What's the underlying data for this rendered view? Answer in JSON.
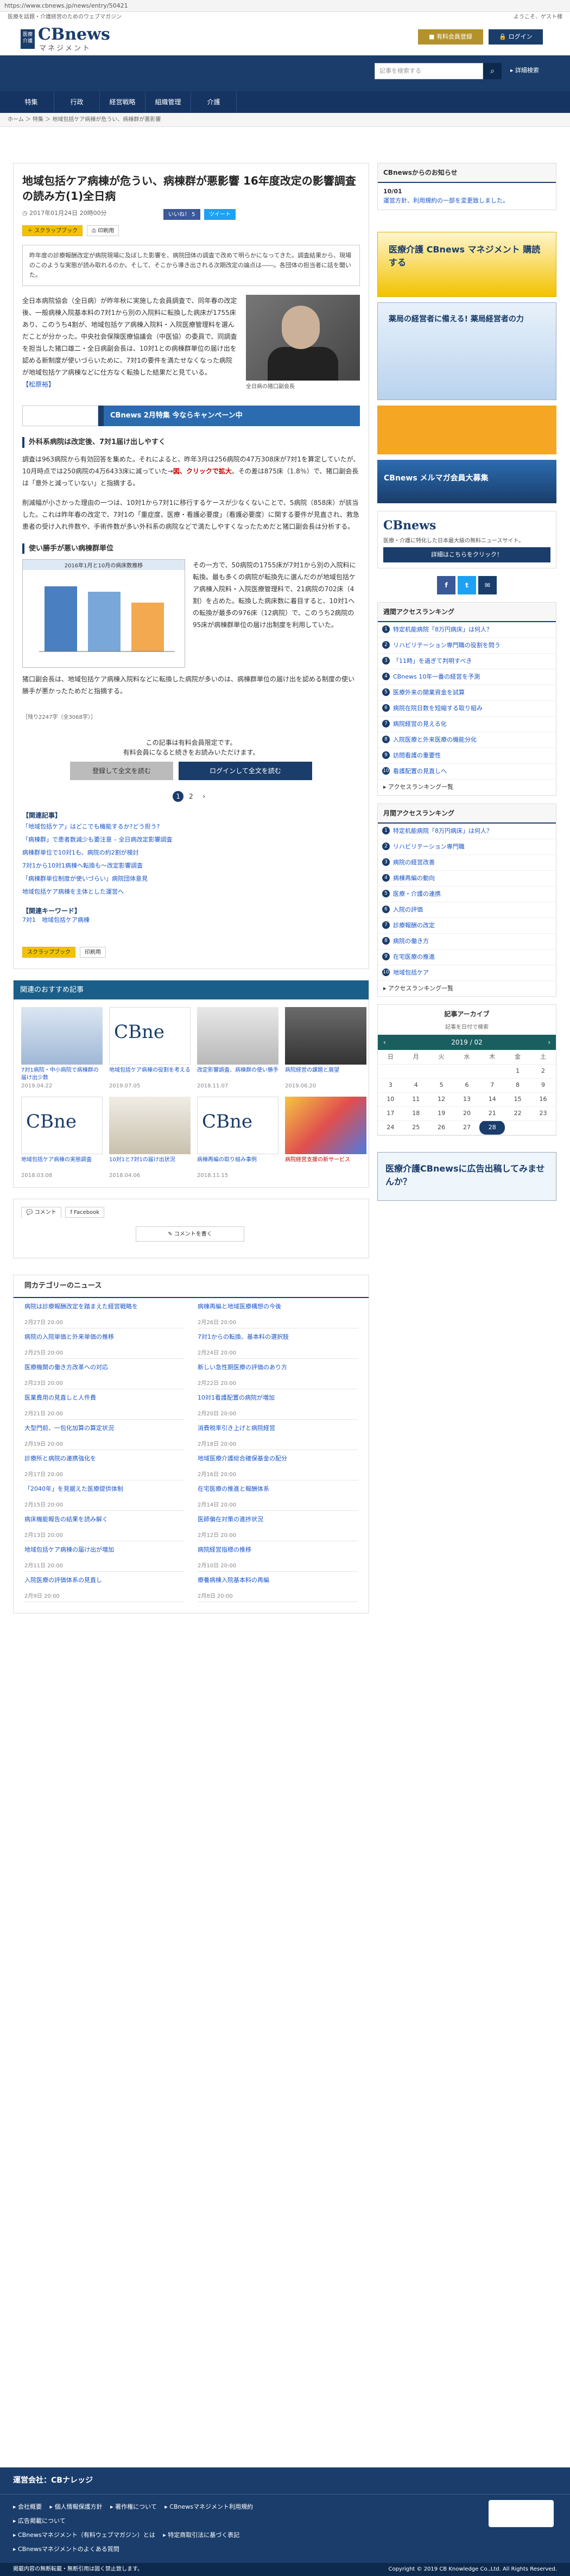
{
  "url": "https://www.cbnews.jp/news/entry/50421",
  "tagline": "医療を話題・介護経営のためのウェブマガジン",
  "welcome": "ようこそ、ゲスト様",
  "logo": {
    "top": "医療介護",
    "title": "CBnews",
    "sub": "マネジメント"
  },
  "header": {
    "trial": "有料会員登録",
    "login": "ログイン"
  },
  "search": {
    "placeholder": "記事を検索する",
    "advanced": "詳細検索"
  },
  "nav": [
    "特集",
    "行政",
    "経営戦略",
    "組織管理",
    "介護"
  ],
  "breadcrumb": "ホーム ＞ 特集 ＞ 地域包括ケア病棟が危うい、病棟群が悪影響",
  "article": {
    "title": "地域包括ケア病棟が危うい、病棟群が悪影響 16年度改定の影響調査の読み方(1)全日病",
    "date": "2017年01月24日 20時00分",
    "like": "いいね！ 5",
    "tweet": "ツイート",
    "scrap": "スクラップブック",
    "print": "印刷用",
    "lead": "昨年度の診療報酬改定が病院現場に及ぼした影響を、病院団体の調査で改めて明らかになってきた。調査結果から、現場のこのような実態が読み取れるのか。そして、そこから導き出される次期改定の論点は――。各団体の担当者に話を聞いた。",
    "p1": "全日本病院協会（全日病）が昨年秋に実施した会員調査で、同年春の改定後、一般病棟入院基本料の7対1から別の入院料に転換した病床が1755床あり、このうち4割が、地域包括ケア病棟入院料・入院医療管理料を選んだことが分かった。中央社会保険医療協議会（中医協）の委員で、同調査を担当した猪口雄二・全日病副会長は、10対1との病棟群単位の届け出を認める新制度が使いづらいために、7対1の要件を満たせなくなった病院が地域包括ケア病棟などに仕方なく転換した結果だと見ている。",
    "p1link": "【松原裕】",
    "cap": "全日病の猪口副会長",
    "banner": "CBnews 2月特集 今ならキャンペーン中",
    "h2a": "外科系病院は改定後、7対1届け出しやすく",
    "p2": "調査は963病院から有効回答を集めた。それによると、昨年3月は256病院の47万308床が7対1を算定していたが、10月時点では250病院の4万6433床に減っていた→",
    "p2link": "図、クリックで拡大",
    "p2b": "。その差は875床（1.8％）で、猪口副会長は「意外と減っていない」と指摘する。",
    "p3": "削減幅が小さかった理由の一つは、10対1から7対1に移行するケースが少なくないことで、5病院（858床）が該当した。これは昨年春の改定で、7対1の「重症度、医療・看護必要度」（看護必要度）に関する要件が見直され、救急患者の受け入れ件数や、手術件数が多い外科系の病院などで満たしやすくなったためだと猪口副会長は分析する。",
    "h2b": "使い勝手が悪い病棟群単位",
    "figtitle": "2016年1月と10月の病床数推移",
    "p4": "その一方で、50病院の1755床が7対1から別の入院料に転換。最も多くの病院が転換先に選んだのが地域包括ケア病棟入院料・入院医療管理料で、21病院の702床（4割）を占めた。転換した病床数に着目すると、10対1への転換が最多の976床（12病院）で、このうち2病院の95床が病棟群単位の届け出制度を利用していた。",
    "p5": "猪口副会長は、地域包括ケア病棟入院料などに転換した病院が多いのは、病棟群単位の届け出を認める制度の使い勝手が悪かったためだと指摘する。",
    "rest": "［残り2247字（全3068字）］",
    "paynote1": "この記事は有料会員限定です。",
    "paynote2": "有料会員になると続きをお読みいただけます。",
    "paybtn1": "登録して全文を読む",
    "paybtn2": "ログインして全文を読む",
    "pages": [
      "1",
      "2",
      "›"
    ],
    "relhd": "【関連記事】",
    "related": [
      "「地域包括ケア」はどこでも機能するか?どう担う?",
      "「病棟群」で患者数減少も要注意 – 全日病改定影響調査",
      "病棟群単位で10対1も、病院の約2割が検討",
      "7対1から10対1病棟へ転換も～改定影響調査",
      "「病棟群単位制度が使いづらい」病院団体意見",
      "地域包括ケア病棟を主体とした運営へ"
    ],
    "kwhd": "【関連キーワード】",
    "kw": "7対1　地域包括ケア病棟"
  },
  "recs": {
    "title": "関連のおすすめ記事",
    "items": [
      {
        "t": "7対1病院・中小病院で病棟群の届け出少数",
        "d": "2019.04.22"
      },
      {
        "t": "地域包括ケア病棟の役割を考える",
        "d": "2019.07.05"
      },
      {
        "t": "改定影響調査、病棟群の使い勝手",
        "d": "2018.11.07"
      },
      {
        "t": "病院経営の課題と展望",
        "d": "2019.06.20"
      },
      {
        "t": "地域包括ケア病棟の実態調査",
        "d": "2018.03.08"
      },
      {
        "t": "10対1と7対1の届け出状況",
        "d": "2018.04.06"
      },
      {
        "t": "病棟再編の取り組み事例",
        "d": "2018.11.15"
      },
      {
        "t": "病院経営支援の新サービス",
        "d": ""
      }
    ]
  },
  "comments": {
    "tab1": "コメント",
    "tab2": "Facebook",
    "write": "コメントを書く"
  },
  "news": {
    "title": "同カテゴリーのニュース",
    "items": [
      {
        "t": "病院は診療報酬改定を踏まえた経営戦略を",
        "d": "2月27日 20:00"
      },
      {
        "t": "病棟再編と地域医療構想の今後",
        "d": "2月26日 20:00"
      },
      {
        "t": "病院の入院単価と外来単価の推移",
        "d": "2月25日 20:00"
      },
      {
        "t": "7対1からの転換、基本料の選択肢",
        "d": "2月24日 20:00"
      },
      {
        "t": "医療機関の働き方改革への対応",
        "d": "2月23日 20:00"
      },
      {
        "t": "新しい急性期医療の評価のあり方",
        "d": "2月22日 20:00"
      },
      {
        "t": "医業費用の見直しと人件費",
        "d": "2月21日 20:00"
      },
      {
        "t": "10対1看護配置の病院が増加",
        "d": "2月20日 20:00"
      },
      {
        "t": "大型門前、一包化加算の算定状況",
        "d": "2月19日 20:00"
      },
      {
        "t": "消費税率引き上げと病院経営",
        "d": "2月18日 20:00"
      },
      {
        "t": "診療所と病院の連携強化を",
        "d": "2月17日 20:00"
      },
      {
        "t": "地域医療介護総合確保基金の配分",
        "d": "2月16日 20:00"
      },
      {
        "t": "「2040年」を見据えた医療提供体制",
        "d": "2月15日 20:00"
      },
      {
        "t": "在宅医療の推進と報酬体系",
        "d": "2月14日 20:00"
      },
      {
        "t": "病床機能報告の結果を読み解く",
        "d": "2月13日 20:00"
      },
      {
        "t": "医師偏在対策の進捗状況",
        "d": "2月12日 20:00"
      },
      {
        "t": "地域包括ケア病棟の届け出が増加",
        "d": "2月11日 20:00"
      },
      {
        "t": "病院経営指標の推移",
        "d": "2月10日 20:00"
      },
      {
        "t": "入院医療の評価体系の見直し",
        "d": "2月9日 20:00"
      },
      {
        "t": "療養病棟入院基本料の再編",
        "d": "2月8日 20:00"
      }
    ]
  },
  "sidebar": {
    "notice_hd": "CBnewsからのお知らせ",
    "notice_date": "10/01",
    "notice": "運営方針、利用規約の一部を変更致しました。",
    "ad1": "医療介護 CBnews マネジメント 購読する",
    "ad2": "薬局の経営者に備える! 薬局経営者の力",
    "ad3": "CBnews メルマガ会員大募集",
    "fb_title": "CBnews",
    "fb_desc": "医療・介護に特化した日本最大級の無料ニュースサイト。",
    "fb_btn": "詳細はこちらをクリック！",
    "rank_week": "週間アクセスランキング",
    "rank_month": "月間アクセスランキング",
    "week": [
      "特定机能病院「8万円病床」は何人？",
      "リハビリテーション専門職の役割を問う",
      "「11時」を過ぎて判明すべき",
      "CBnews 10年一番の経営を予測",
      "医療外来の開業資金を試算",
      "病院在院日数を短縮する取り組み",
      "病院経営の見える化",
      "入院医療と外来医療の機能分化",
      "訪問看護の重要性",
      "看護配置の見直しへ"
    ],
    "month": [
      "特定机能病院「8万円病床」は何人？",
      "リハビリテーション専門職",
      "病院の経営改善",
      "病棟再編の動向",
      "医療・介護の連携",
      "入院の評価",
      "診療報酬の改定",
      "病院の働き方",
      "在宅医療の推進",
      "地域包括ケア"
    ],
    "more": "アクセスランキング一覧",
    "arch_hd": "記事アーカイブ",
    "arch_sub": "記事を日付で検索",
    "cal_month": "2019 / 02",
    "cal_head": [
      "日",
      "月",
      "火",
      "水",
      "木",
      "金",
      "土"
    ],
    "cal": [
      [
        "",
        "",
        "",
        "",
        "",
        "1",
        "2"
      ],
      [
        "3",
        "4",
        "5",
        "6",
        "7",
        "8",
        "9"
      ],
      [
        "10",
        "11",
        "12",
        "13",
        "14",
        "15",
        "16"
      ],
      [
        "17",
        "18",
        "19",
        "20",
        "21",
        "22",
        "23"
      ],
      [
        "24",
        "25",
        "26",
        "27",
        "28",
        "",
        ""
      ]
    ],
    "adbottom": "医療介護CBnewsに広告出稿してみませんか？"
  },
  "footer": {
    "title": "運営会社：CBナレッジ",
    "links": [
      "会社概要",
      "個人情報保護方針",
      "著作権について",
      "CBnewsマネジメント利用規約",
      "広告掲載について",
      "CBnewsマネジメント（有料ウェブマガジン）とは",
      "特定商取引法に基づく表記",
      "CBnewsマネジメントのよくある質問"
    ],
    "bottom": "掲載内容の無断転載・無断引用は固く禁止致します。",
    "copy": "Copyright © 2019 CB Knowledge Co.,Ltd. All Rights Reserved."
  }
}
